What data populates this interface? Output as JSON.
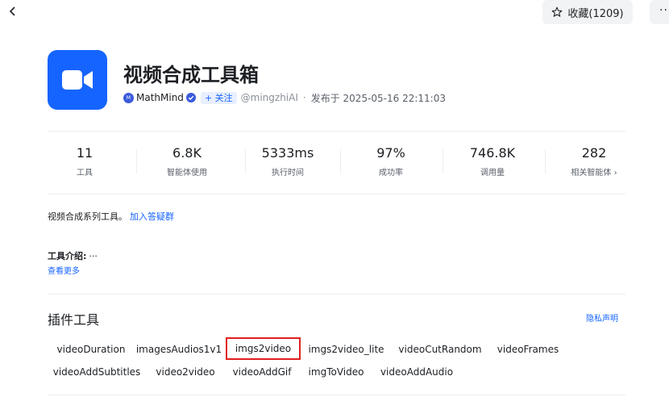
{
  "topbar": {
    "favorite_label": "收藏(1209)",
    "more_label": "···"
  },
  "header": {
    "title": "视频合成工具箱",
    "avatar_text": "M",
    "author": "MathMind",
    "follow_label": "+ 关注",
    "handle": "@mingzhiAI",
    "separator": "·",
    "publish": "发布于 2025-05-16 22:11:03"
  },
  "stats": [
    {
      "value": "11",
      "label": "工具"
    },
    {
      "value": "6.8K",
      "label": "智能体使用"
    },
    {
      "value": "5333ms",
      "label": "执行时间"
    },
    {
      "value": "97%",
      "label": "成功率"
    },
    {
      "value": "746.8K",
      "label": "调用量"
    },
    {
      "value": "282",
      "label": "相关智能体 ›"
    }
  ],
  "description": {
    "text": "视频合成系列工具。",
    "link": "加入答疑群"
  },
  "intro": {
    "label": "工具介绍:",
    "ellipsis": "···",
    "more": "查看更多"
  },
  "plugins": {
    "title": "插件工具",
    "privacy": "隐私声明",
    "tools": [
      "videoDuration",
      "imagesAudios1v1",
      "imgs2video",
      "imgs2video_lite",
      "videoCutRandom",
      "videoFrames",
      "videoAddSubtitles",
      "video2video",
      "videoAddGif",
      "imgToVideo",
      "videoAddAudio"
    ],
    "selected_tool": "imgs2video"
  },
  "colors": {
    "accent": "#1664ff",
    "selection_border": "#e02020"
  }
}
